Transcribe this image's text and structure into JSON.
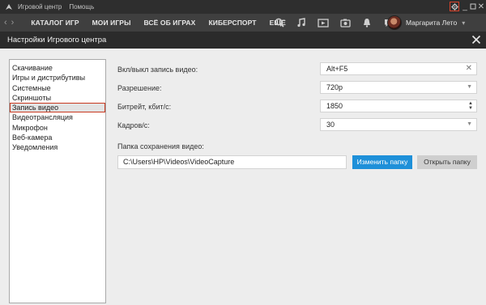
{
  "titlebar": {
    "menu": [
      "Игровой центр",
      "Помощь"
    ],
    "settings_icon": "gear-icon",
    "minimize_symbol": "_",
    "maximize_icon": "maximize-icon",
    "close_symbol": "✕"
  },
  "nav": {
    "back": "‹",
    "forward": "›",
    "items": [
      "КАТАЛОГ ИГР",
      "МОИ ИГРЫ",
      "ВСЁ ОБ ИГРАХ",
      "КИБЕРСПОРТ",
      "ЕЩЁ"
    ],
    "icons": [
      "search-icon",
      "music-icon",
      "video-icon",
      "screenshot-icon",
      "notifications-icon",
      "chat-icon"
    ],
    "user_name": "Маргарита Лето",
    "user_chevron": "▾"
  },
  "dialog": {
    "title": "Настройки Игрового центра",
    "close_symbol": "✕"
  },
  "categories": [
    "Скачивание",
    "Игры и дистрибутивы",
    "Системные",
    "Скриншоты",
    "Запись видео",
    "Видеотрансляция",
    "Микрофон",
    "Веб-камера",
    "Уведомления"
  ],
  "active_category": "Запись видео",
  "settings": {
    "toggle_label": "Вкл/выкл запись видео:",
    "toggle_value": "Alt+F5",
    "resolution_label": "Разрешение:",
    "resolution_value": "720p",
    "bitrate_label": "Битрейт, кбит/с:",
    "bitrate_value": "1850",
    "fps_label": "Кадров/с:",
    "fps_value": "30",
    "folder_label": "Папка сохранения видео:",
    "folder_value": "C:\\Users\\HP\\Videos\\VideoCapture",
    "change_folder": "Изменить папку",
    "open_folder": "Открыть папку",
    "clear_symbol": "✕",
    "dropdown_symbol": "▼",
    "spin_up": "▲",
    "spin_down": "▼"
  },
  "colors": {
    "accent_blue": "#1e90d9",
    "active_outline": "#c8381f",
    "titlebar_bg": "#2e2e2e",
    "navbar_bg": "#3f3f3f"
  }
}
